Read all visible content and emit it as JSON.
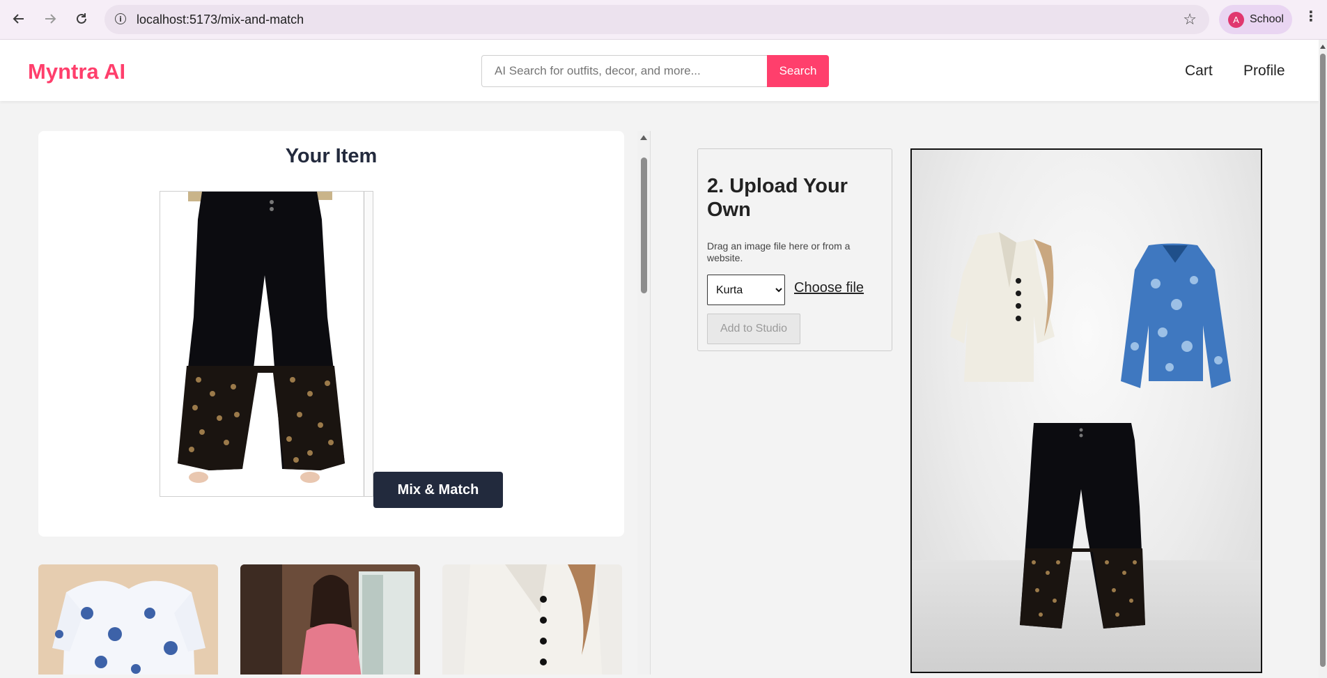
{
  "browser": {
    "url": "localhost:5173/mix-and-match",
    "profile_name": "School",
    "profile_initial": "A"
  },
  "header": {
    "brand": "Myntra AI",
    "search_placeholder": "AI Search for outfits, decor, and more...",
    "search_button": "Search",
    "nav": [
      "Cart",
      "Profile"
    ]
  },
  "item_card": {
    "title": "Your Item",
    "mix_button": "Mix & Match"
  },
  "upload": {
    "title": "2. Upload Your Own",
    "description": "Drag an image file here or from a website.",
    "selected_type": "Kurta",
    "choose_file": "Choose file",
    "add_button": "Add to Studio"
  },
  "colors": {
    "brand": "#ff3f6c",
    "primary_dark": "#222a3d"
  }
}
